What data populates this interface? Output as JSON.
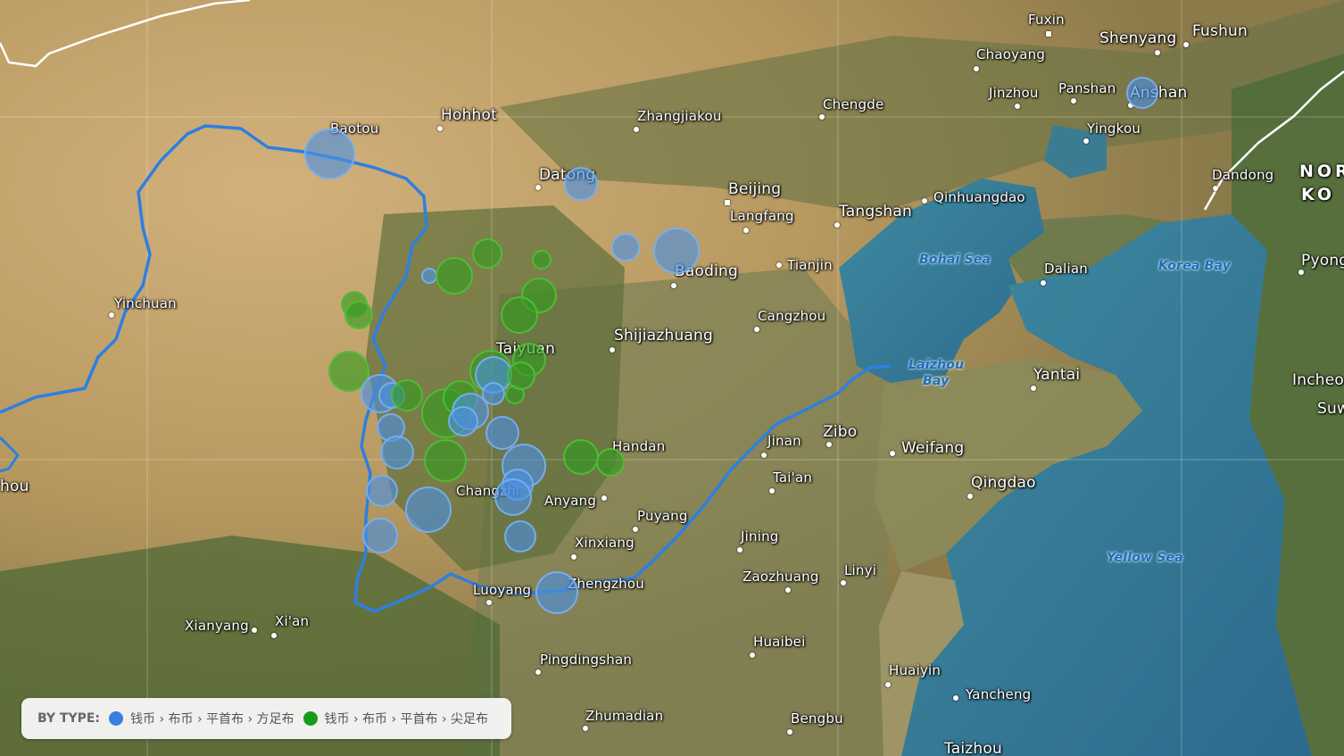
{
  "legend": {
    "title": "BY TYPE:",
    "items": [
      {
        "label": "钱币 › 布币 › 平首布 › 方足布",
        "color": "#3a7fe0"
      },
      {
        "label": "钱币 › 布币 › 平首布 › 尖足布",
        "color": "#1a9a1a"
      }
    ]
  },
  "places": [
    {
      "id": "fuxin",
      "name": "Fuxin"
    },
    {
      "id": "shenyang",
      "name": "Shenyang"
    },
    {
      "id": "fushun",
      "name": "Fushun"
    },
    {
      "id": "chaoyang",
      "name": "Chaoyang"
    },
    {
      "id": "jinzhou",
      "name": "Jinzhou"
    },
    {
      "id": "panshan",
      "name": "Panshan"
    },
    {
      "id": "anshan",
      "name": "Anshan"
    },
    {
      "id": "yingkou",
      "name": "Yingkou"
    },
    {
      "id": "dandong",
      "name": "Dandong"
    },
    {
      "id": "chengde",
      "name": "Chengde"
    },
    {
      "id": "zhangjiakou",
      "name": "Zhangjiakou"
    },
    {
      "id": "hohhot",
      "name": "Hohhot"
    },
    {
      "id": "baotou",
      "name": "Baotou"
    },
    {
      "id": "datong",
      "name": "Datong"
    },
    {
      "id": "beijing",
      "name": "Beijing"
    },
    {
      "id": "langfang",
      "name": "Langfang"
    },
    {
      "id": "tangshan",
      "name": "Tangshan"
    },
    {
      "id": "qinhuangdao",
      "name": "Qinhuangdao"
    },
    {
      "id": "tianjin",
      "name": "Tianjin"
    },
    {
      "id": "baoding",
      "name": "Baoding"
    },
    {
      "id": "dalian",
      "name": "Dalian"
    },
    {
      "id": "pyong",
      "name": "Pyong"
    },
    {
      "id": "yinchuan",
      "name": "Yinchuan"
    },
    {
      "id": "cangzhou",
      "name": "Cangzhou"
    },
    {
      "id": "shijiazhuang",
      "name": "Shijiazhuang"
    },
    {
      "id": "taiyuan",
      "name": "Taiyuan"
    },
    {
      "id": "yantai",
      "name": "Yantai"
    },
    {
      "id": "incheon",
      "name": "Incheo"
    },
    {
      "id": "suwon",
      "name": "Suw"
    },
    {
      "id": "zibo",
      "name": "Zibo"
    },
    {
      "id": "jinan",
      "name": "Jinan"
    },
    {
      "id": "weifang",
      "name": "Weifang"
    },
    {
      "id": "handan",
      "name": "Handan"
    },
    {
      "id": "taian",
      "name": "Tai'an"
    },
    {
      "id": "changzhi",
      "name": "Changzhi"
    },
    {
      "id": "qingdao",
      "name": "Qingdao"
    },
    {
      "id": "anyang",
      "name": "Anyang"
    },
    {
      "id": "puyang",
      "name": "Puyang"
    },
    {
      "id": "xinxiang",
      "name": "Xinxiang"
    },
    {
      "id": "jining",
      "name": "Jining"
    },
    {
      "id": "zaozhuang",
      "name": "Zaozhuang"
    },
    {
      "id": "linyi",
      "name": "Linyi"
    },
    {
      "id": "luoyang",
      "name": "Luoyang"
    },
    {
      "id": "zhengzhou",
      "name": "Zhengzhou"
    },
    {
      "id": "xianyang",
      "name": "Xianyang"
    },
    {
      "id": "xian",
      "name": "Xi'an"
    },
    {
      "id": "huaibei",
      "name": "Huaibei"
    },
    {
      "id": "pingdingshan",
      "name": "Pingdingshan"
    },
    {
      "id": "huaiyin",
      "name": "Huaiyin"
    },
    {
      "id": "yancheng",
      "name": "Yancheng"
    },
    {
      "id": "zhumadian",
      "name": "Zhumadian"
    },
    {
      "id": "bengbu",
      "name": "Bengbu"
    },
    {
      "id": "taizhou",
      "name": "Taizhou"
    },
    {
      "id": "lanzhou",
      "name": "hou"
    }
  ],
  "water": {
    "bohai": "Bohai Sea",
    "korea_bay": "Korea Bay",
    "laizhou_1": "Laizhou",
    "laizhou_2": "Bay",
    "yellow_sea": "Yellow Sea"
  },
  "country": {
    "north_korea": "NOR",
    "north_korea_2": "KO"
  },
  "markers": [
    {
      "type": "fangzu",
      "size": "large"
    },
    {
      "type": "fangzu",
      "size": "medium"
    },
    {
      "type": "fangzu",
      "size": "large"
    },
    {
      "type": "fangzu",
      "size": "medium"
    },
    {
      "type": "fangzu",
      "size": "medium"
    },
    {
      "type": "fangzu",
      "size": "small"
    },
    {
      "type": "jianzu",
      "size": "medium"
    },
    {
      "type": "jianzu",
      "size": "small"
    },
    {
      "type": "jianzu",
      "size": "small"
    },
    {
      "type": "jianzu",
      "size": "medium"
    },
    {
      "type": "jianzu",
      "size": "medium"
    },
    {
      "type": "jianzu",
      "size": "medium"
    },
    {
      "type": "jianzu",
      "size": "small"
    },
    {
      "type": "jianzu",
      "size": "small"
    },
    {
      "type": "jianzu",
      "size": "medium"
    },
    {
      "type": "jianzu",
      "size": "medium"
    },
    {
      "type": "fangzu",
      "size": "medium"
    },
    {
      "type": "fangzu",
      "size": "small"
    },
    {
      "type": "jianzu",
      "size": "small"
    },
    {
      "type": "jianzu",
      "size": "medium"
    },
    {
      "type": "jianzu",
      "size": "large"
    },
    {
      "type": "fangzu",
      "size": "medium"
    },
    {
      "type": "fangzu",
      "size": "medium"
    },
    {
      "type": "jianzu",
      "size": "medium"
    },
    {
      "type": "jianzu",
      "size": "small"
    },
    {
      "type": "fangzu",
      "size": "medium"
    },
    {
      "type": "fangzu",
      "size": "small"
    },
    {
      "type": "fangzu",
      "size": "medium"
    },
    {
      "type": "fangzu",
      "size": "medium"
    },
    {
      "type": "fangzu",
      "size": "medium"
    },
    {
      "type": "fangzu",
      "size": "medium"
    },
    {
      "type": "jianzu",
      "size": "large"
    },
    {
      "type": "fangzu",
      "size": "medium"
    },
    {
      "type": "jianzu",
      "size": "medium"
    },
    {
      "type": "jianzu",
      "size": "small"
    },
    {
      "type": "fangzu",
      "size": "large"
    },
    {
      "type": "fangzu",
      "size": "medium"
    },
    {
      "type": "fangzu",
      "size": "medium"
    },
    {
      "type": "fangzu",
      "size": "medium"
    },
    {
      "type": "fangzu",
      "size": "large"
    },
    {
      "type": "fangzu",
      "size": "medium"
    },
    {
      "type": "fangzu",
      "size": "medium"
    },
    {
      "type": "fangzu",
      "size": "large"
    }
  ]
}
